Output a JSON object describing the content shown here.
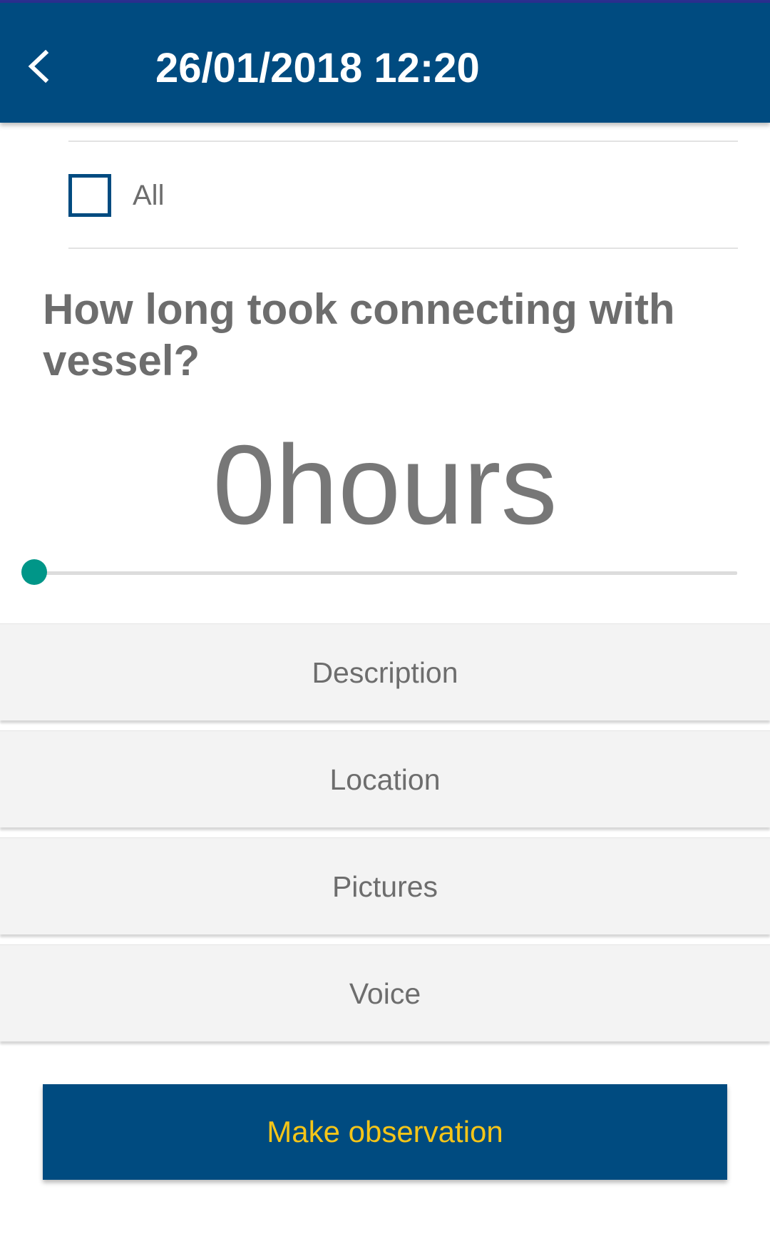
{
  "app_bar": {
    "title": "26/01/2018 12:20",
    "back_icon": "chevron-left-icon",
    "background": "#004b80"
  },
  "filter": {
    "all_label": "All",
    "all_checked": false
  },
  "question": {
    "text": "How long took connecting with vessel?"
  },
  "duration": {
    "value": "0",
    "unit": "hours",
    "slider_fraction": 0,
    "thumb_color": "#009688"
  },
  "sections": [
    {
      "label": "Description"
    },
    {
      "label": "Location"
    },
    {
      "label": "Pictures"
    },
    {
      "label": "Voice"
    }
  ],
  "submit": {
    "label": "Make observation",
    "background": "#004b80",
    "text_color": "#f5c518"
  }
}
